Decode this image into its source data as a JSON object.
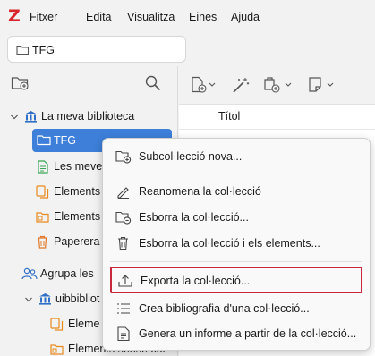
{
  "app": {
    "logo": "Z"
  },
  "menubar": {
    "items": [
      "Fitxer",
      "Edita",
      "Visualitza",
      "Eines",
      "Ajuda"
    ]
  },
  "tab": {
    "label": "TFG"
  },
  "items_pane": {
    "column_title": "Títol"
  },
  "tree": {
    "library": "La meva biblioteca",
    "tfg": "TFG",
    "my_pubs": "Les meves",
    "elements_1": "Elements",
    "elements_2": "Elements",
    "trash": "Paperera",
    "group_header": "Agrupa les",
    "group_lib": "uibbibliot",
    "group_item_1": "Eleme",
    "group_item_2": "Elements sense col"
  },
  "context_menu": {
    "items": [
      "Subcol·lecció nova...",
      "Reanomena la col·lecció",
      "Esborra la col·lecció...",
      "Esborra la col·lecció i els elements...",
      "Exporta la col·lecció...",
      "Crea bibliografia d'una col·lecció...",
      "Genera un informe a partir de la col·lecció..."
    ],
    "highlighted": "Exporta la col·lecció..."
  },
  "colors": {
    "accent": "#3d7fd9",
    "highlight_border": "#c8283b",
    "library_icon": "#2f6fc7",
    "doc_icon_green": "#3aa655",
    "doc_icon_orange": "#e98a1c",
    "trash_icon": "#e07a2a",
    "logo_red": "#d8242b"
  }
}
